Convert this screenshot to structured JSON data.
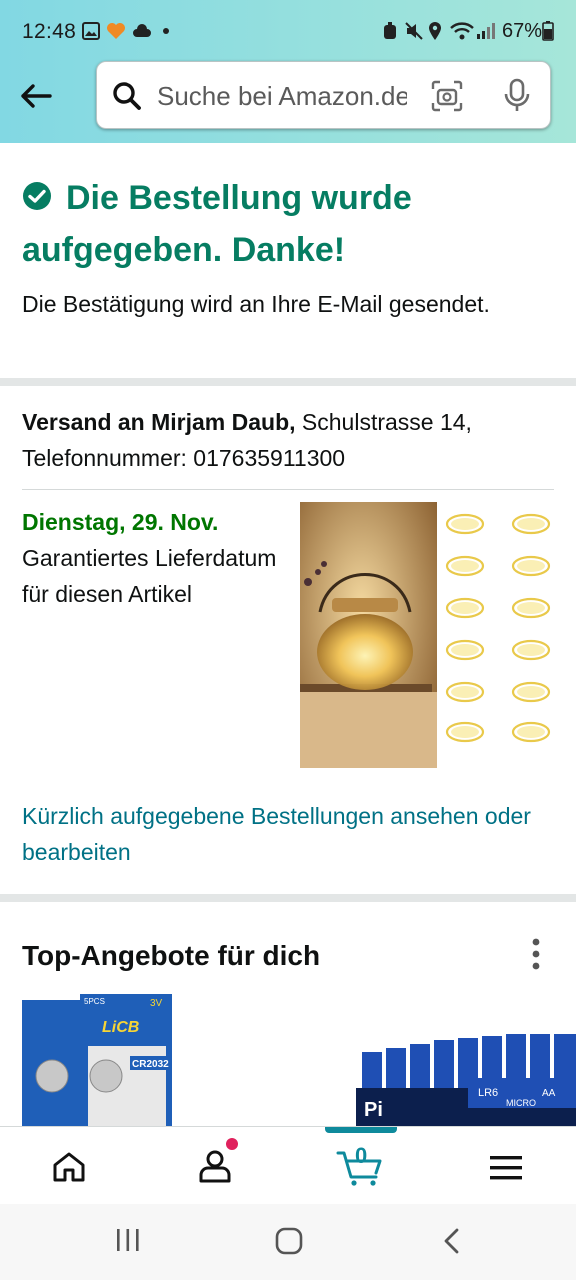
{
  "status_bar": {
    "time": "12:48",
    "battery": "67%"
  },
  "search": {
    "placeholder": "Suche bei Amazon.de"
  },
  "confirmation": {
    "title": "Die Bestellung wurde aufgegeben. Danke!",
    "subtitle": "Die Bestätigung wird an Ihre E-Mail gesendet."
  },
  "shipping": {
    "prefix": "Versand an Mirjam Daub,",
    "address": " Schulstrasse 14, Telefonnummer: 017635911300"
  },
  "delivery": {
    "date": "Dienstag, 29. Nov.",
    "note": "Garantiertes Lieferdatum für diesen Artikel"
  },
  "orders_link": "Kürzlich aufgegebene Bestellungen ansehen oder bearbeiten",
  "deals": {
    "title": "Top-Angebote für dich",
    "item1_text": {
      "pack": "5PCS",
      "brand": "LiCB",
      "voltage": "3V",
      "model": "CR2032"
    },
    "item2_text": {
      "brand": "Pi",
      "type": "LR6",
      "size": "AA",
      "label": "MICRO"
    }
  },
  "bottom_nav": {
    "cart_count": "0"
  },
  "colors": {
    "accent_green": "#067d62",
    "link_teal": "#007185",
    "delivery_green": "#007600",
    "cart_teal": "#0e8a9c"
  },
  "icons": [
    "back-arrow-icon",
    "search-icon",
    "camera-icon",
    "microphone-icon",
    "check-circle-icon",
    "more-vertical-icon",
    "home-icon",
    "account-icon",
    "cart-icon",
    "menu-icon"
  ]
}
